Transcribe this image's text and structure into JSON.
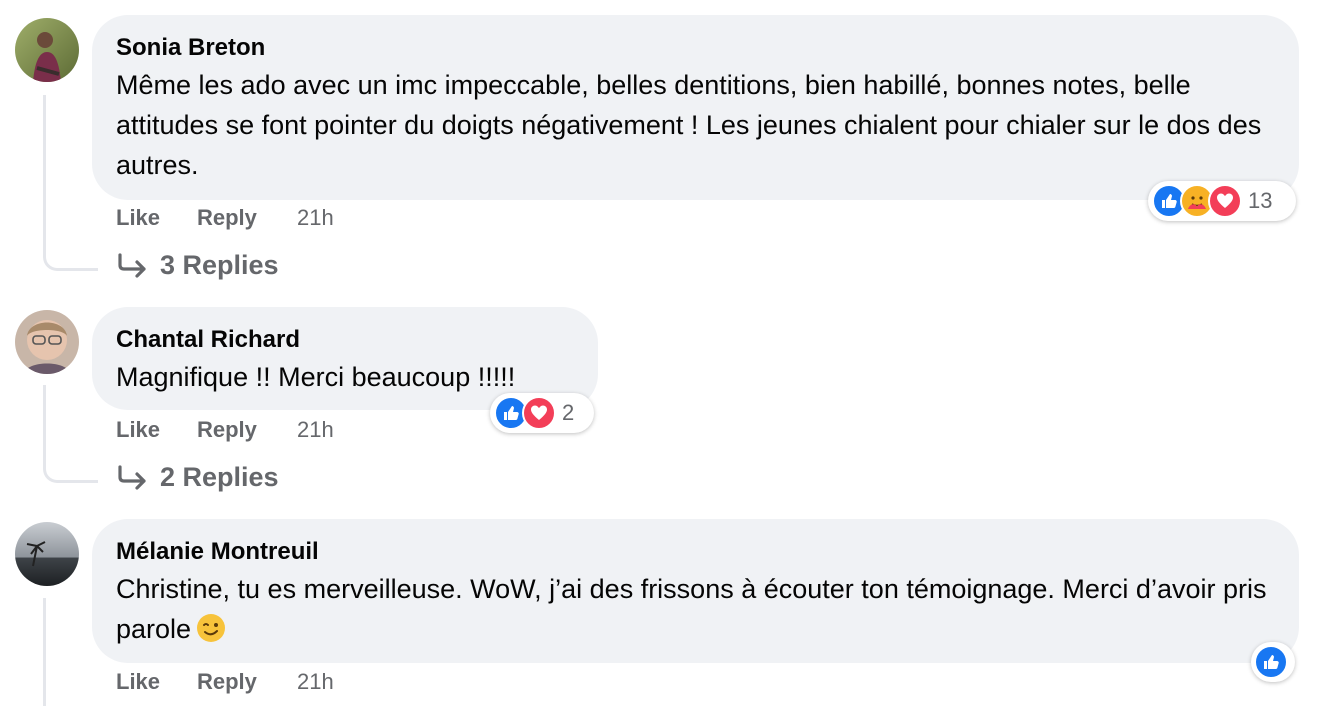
{
  "comments": [
    {
      "author": "Sonia Breton",
      "text": "Même les ado avec un imc impeccable, belles dentitions, bien habillé, bonnes notes, belle attitudes se font pointer du doigts négativement ! Les jeunes chialent pour chialer sur le dos des autres.",
      "like": "Like",
      "reply": "Reply",
      "time": "21h",
      "reactions": [
        "like-icon",
        "care-icon",
        "love-icon"
      ],
      "reaction_count": "13",
      "replies_label": "3 Replies"
    },
    {
      "author": "Chantal Richard",
      "text": "Magnifique !! Merci beaucoup !!!!!",
      "like": "Like",
      "reply": "Reply",
      "time": "21h",
      "reactions": [
        "like-icon",
        "love-icon"
      ],
      "reaction_count": "2",
      "replies_label": "2 Replies"
    },
    {
      "author": "Mélanie Montreuil",
      "text": "Christine, tu es merveilleuse. WoW, j’ai des frissons à écouter ton témoignage. Merci d’avoir pris parole",
      "emoji": "winking-face-emoji",
      "like": "Like",
      "reply": "Reply",
      "time": "21h",
      "reactions": [
        "like-icon"
      ]
    }
  ],
  "colors": {
    "bubble": "#f0f2f5",
    "muted": "#65676b",
    "like_blue": "#1877f2",
    "love_red": "#f33e58",
    "care_yellow": "#f7b125"
  }
}
